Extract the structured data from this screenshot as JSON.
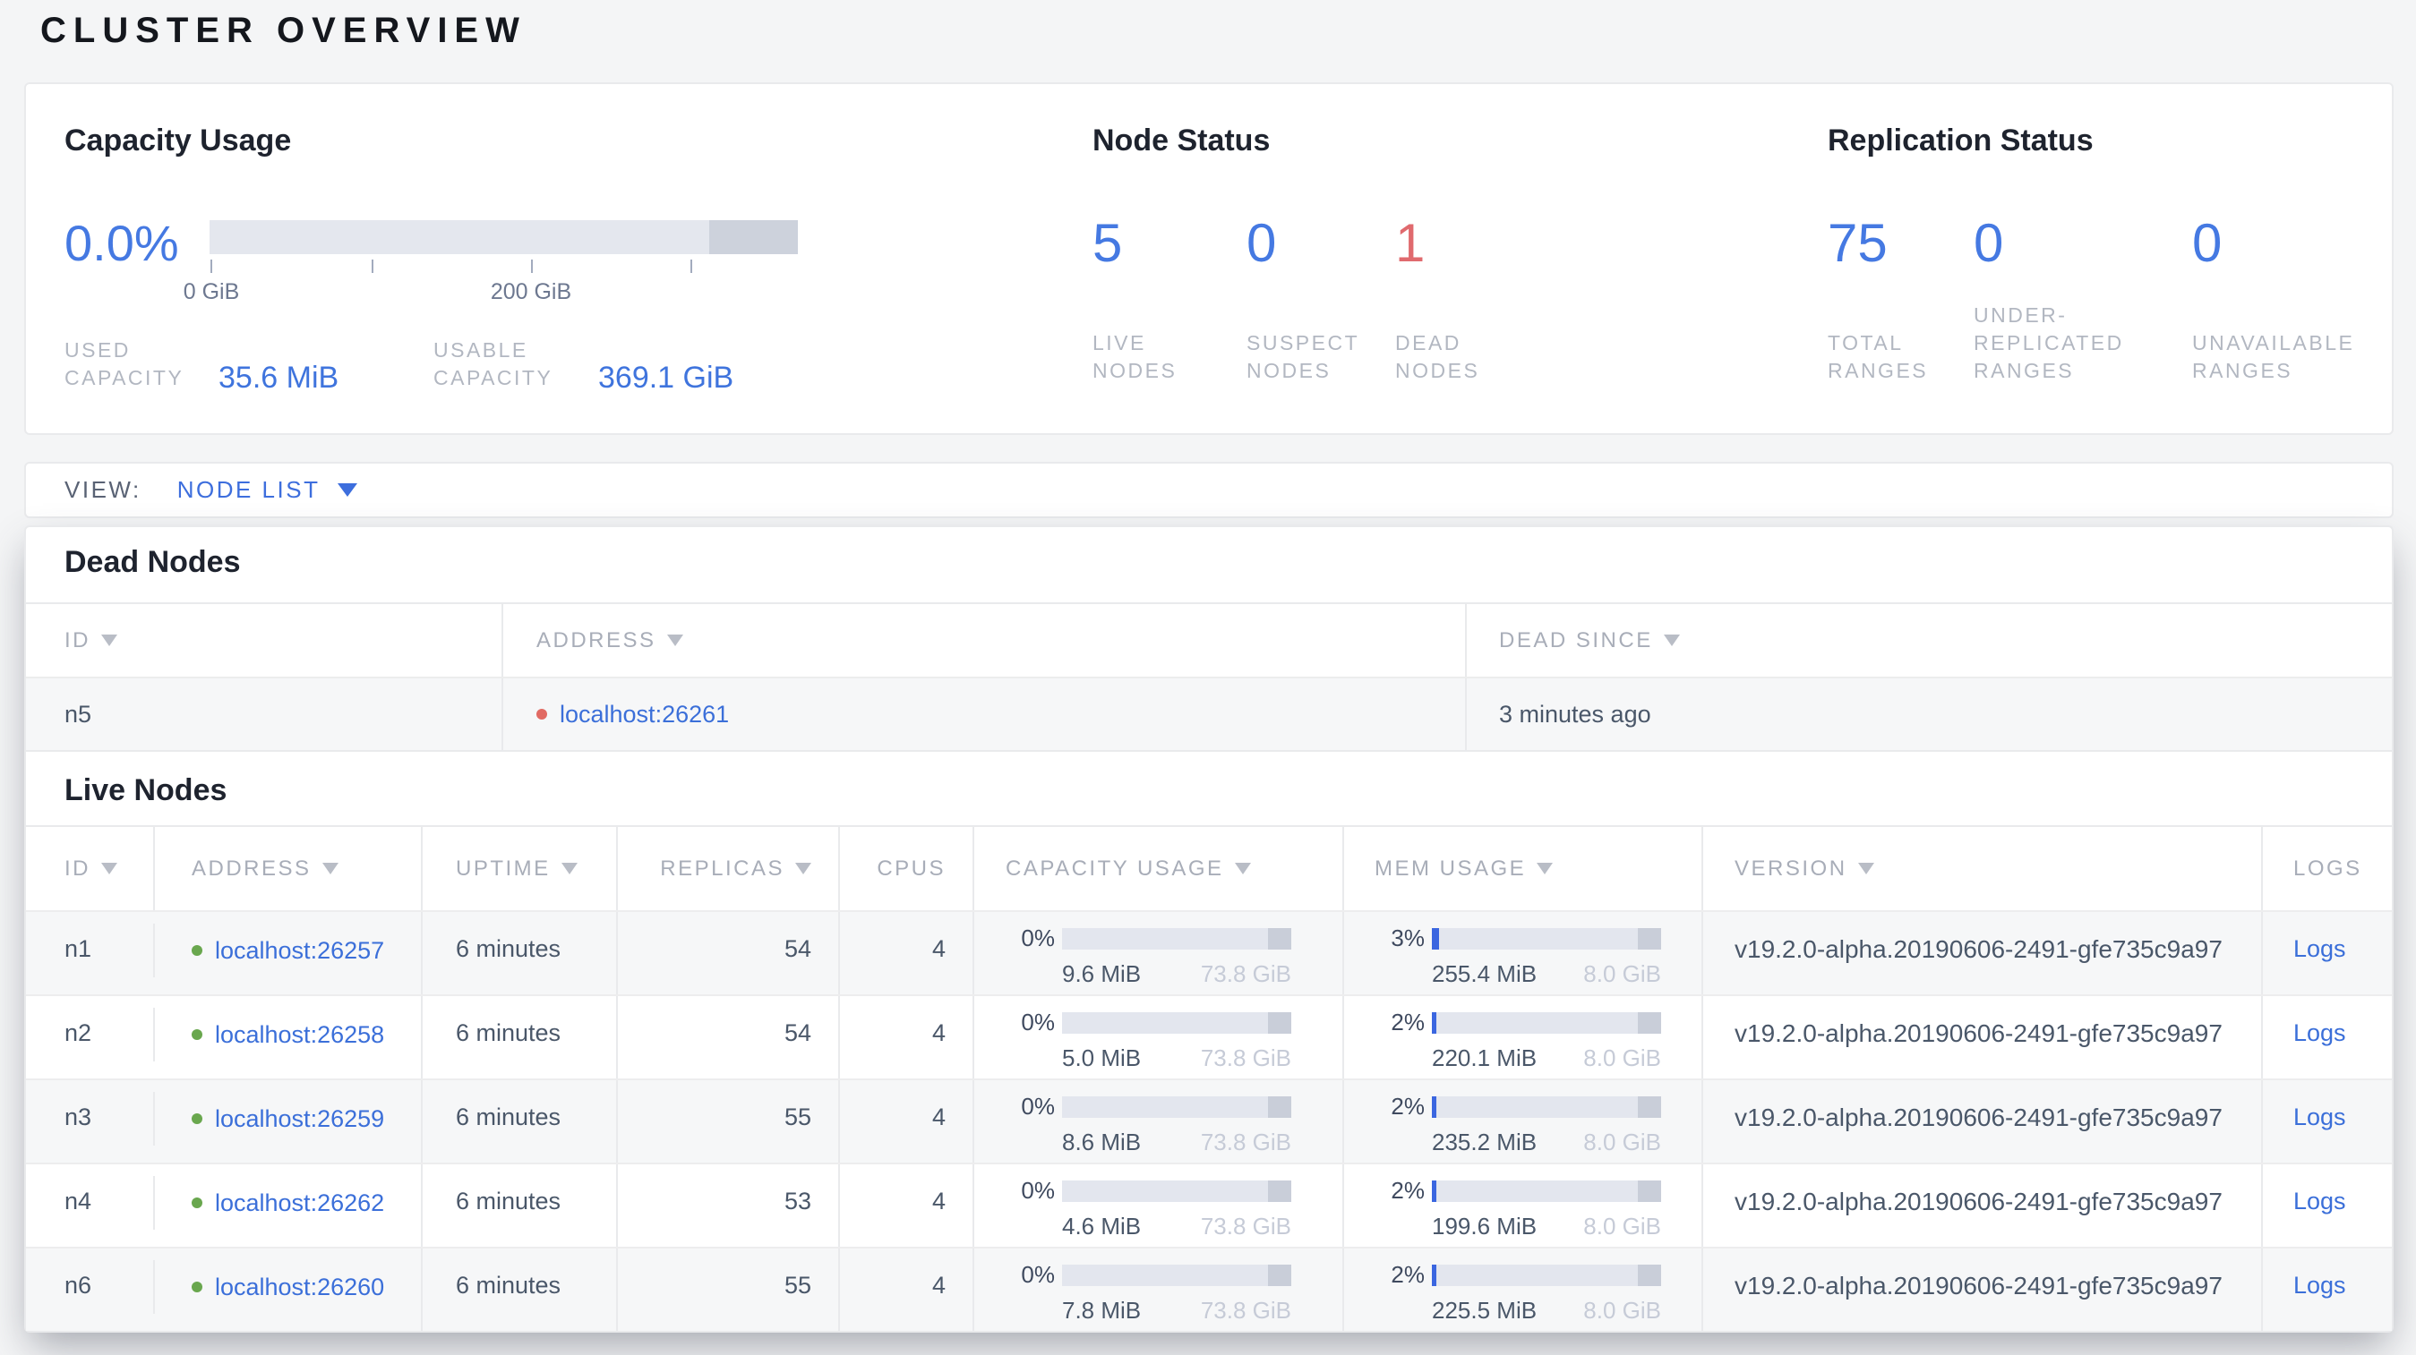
{
  "page": {
    "title": "CLUSTER OVERVIEW"
  },
  "colors": {
    "accent_blue": "#4579e2",
    "link_blue": "#3b6fd9",
    "alert_red": "#e06a6e",
    "live_green_dot": "#69a74e",
    "dead_red_dot": "#e16a63"
  },
  "summary": {
    "capacity": {
      "title": "Capacity Usage",
      "percent": "0.0%",
      "tick_labels": [
        "0 GiB",
        "200 GiB"
      ],
      "used_label": "USED CAPACITY",
      "used_value": "35.6 MiB",
      "usable_label": "USABLE CAPACITY",
      "usable_value": "369.1 GiB"
    },
    "node_status": {
      "title": "Node Status",
      "stats": [
        {
          "value": "5",
          "label": "LIVE NODES"
        },
        {
          "value": "0",
          "label": "SUSPECT NODES"
        },
        {
          "value": "1",
          "label": "DEAD NODES"
        }
      ]
    },
    "replication": {
      "title": "Replication Status",
      "stats": [
        {
          "value": "75",
          "label": "TOTAL RANGES"
        },
        {
          "value": "0",
          "label": "UNDER-REPLICATED RANGES"
        },
        {
          "value": "0",
          "label": "UNAVAILABLE RANGES"
        }
      ]
    }
  },
  "view_bar": {
    "label": "VIEW:",
    "selected": "NODE LIST"
  },
  "dead_nodes": {
    "heading": "Dead Nodes",
    "columns": [
      "ID",
      "ADDRESS",
      "DEAD SINCE"
    ],
    "rows": [
      {
        "id": "n5",
        "address": "localhost:26261",
        "dead_since": "3 minutes ago"
      }
    ]
  },
  "live_nodes": {
    "heading": "Live Nodes",
    "columns": [
      "ID",
      "ADDRESS",
      "UPTIME",
      "REPLICAS",
      "CPUS",
      "CAPACITY USAGE",
      "MEM USAGE",
      "VERSION",
      "LOGS"
    ],
    "rows": [
      {
        "id": "n1",
        "address": "localhost:26257",
        "uptime": "6 minutes",
        "replicas": "54",
        "cpus": "4",
        "cap_pct": "0%",
        "cap_used": "9.6 MiB",
        "cap_total": "73.8 GiB",
        "mem_pct": "3%",
        "mem_used": "255.4 MiB",
        "mem_total": "8.0 GiB",
        "version": "v19.2.0-alpha.20190606-2491-gfe735c9a97",
        "logs": "Logs"
      },
      {
        "id": "n2",
        "address": "localhost:26258",
        "uptime": "6 minutes",
        "replicas": "54",
        "cpus": "4",
        "cap_pct": "0%",
        "cap_used": "5.0 MiB",
        "cap_total": "73.8 GiB",
        "mem_pct": "2%",
        "mem_used": "220.1 MiB",
        "mem_total": "8.0 GiB",
        "version": "v19.2.0-alpha.20190606-2491-gfe735c9a97",
        "logs": "Logs"
      },
      {
        "id": "n3",
        "address": "localhost:26259",
        "uptime": "6 minutes",
        "replicas": "55",
        "cpus": "4",
        "cap_pct": "0%",
        "cap_used": "8.6 MiB",
        "cap_total": "73.8 GiB",
        "mem_pct": "2%",
        "mem_used": "235.2 MiB",
        "mem_total": "8.0 GiB",
        "version": "v19.2.0-alpha.20190606-2491-gfe735c9a97",
        "logs": "Logs"
      },
      {
        "id": "n4",
        "address": "localhost:26262",
        "uptime": "6 minutes",
        "replicas": "53",
        "cpus": "4",
        "cap_pct": "0%",
        "cap_used": "4.6 MiB",
        "cap_total": "73.8 GiB",
        "mem_pct": "2%",
        "mem_used": "199.6 MiB",
        "mem_total": "8.0 GiB",
        "version": "v19.2.0-alpha.20190606-2491-gfe735c9a97",
        "logs": "Logs"
      },
      {
        "id": "n6",
        "address": "localhost:26260",
        "uptime": "6 minutes",
        "replicas": "55",
        "cpus": "4",
        "cap_pct": "0%",
        "cap_used": "7.8 MiB",
        "cap_total": "73.8 GiB",
        "mem_pct": "2%",
        "mem_used": "225.5 MiB",
        "mem_total": "8.0 GiB",
        "version": "v19.2.0-alpha.20190606-2491-gfe735c9a97",
        "logs": "Logs"
      }
    ]
  }
}
